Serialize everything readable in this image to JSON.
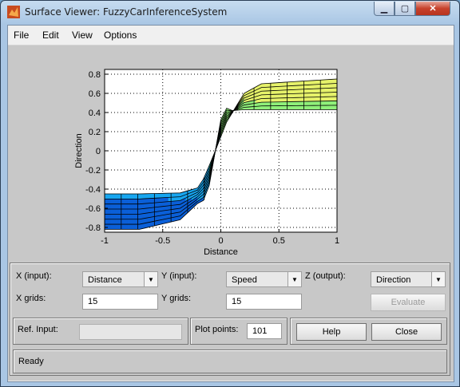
{
  "window": {
    "title": "Surface Viewer: FuzzyCarInferenceSystem",
    "app_icon": "matlab-icon"
  },
  "menu": [
    "File",
    "Edit",
    "View",
    "Options"
  ],
  "controls": {
    "x_label": "X (input):",
    "x_value": "Distance",
    "y_label": "Y (input):",
    "y_value": "Speed",
    "z_label": "Z (output):",
    "z_value": "Direction",
    "x_grids_label": "X grids:",
    "x_grids_value": "15",
    "y_grids_label": "Y grids:",
    "y_grids_value": "15",
    "evaluate_label": "Evaluate",
    "ref_input_label": "Ref. Input:",
    "ref_input_value": "",
    "plot_points_label": "Plot points:",
    "plot_points_value": "101",
    "help_label": "Help",
    "close_label": "Close",
    "status": "Ready"
  },
  "chart_data": {
    "type": "surface",
    "xlabel": "Distance",
    "ylabel": "Direction",
    "xlim": [
      -1,
      1
    ],
    "ylim": [
      -0.85,
      0.85
    ],
    "xticks": [
      "-1",
      "-0.5",
      "0",
      "0.5",
      "1"
    ],
    "yticks": [
      "0.8",
      "0.6",
      "0.4",
      "0.2",
      "0",
      "-0.2",
      "-0.4",
      "-0.6",
      "-0.8"
    ],
    "grid": true,
    "colormap": [
      "#0a5fd8",
      "#17a6f0",
      "#2fd6c6",
      "#8ff07a",
      "#e6f26a"
    ],
    "profile_back": [
      [
        -1,
        -0.45
      ],
      [
        -0.7,
        -0.45
      ],
      [
        -0.35,
        -0.44
      ],
      [
        -0.18,
        -0.38
      ],
      [
        -0.08,
        -0.1
      ],
      [
        0.05,
        0.3
      ],
      [
        0.2,
        0.6
      ],
      [
        0.35,
        0.7
      ],
      [
        0.6,
        0.72
      ],
      [
        1,
        0.75
      ]
    ],
    "profile_front": [
      [
        -1,
        -0.82
      ],
      [
        -0.7,
        -0.82
      ],
      [
        -0.35,
        -0.72
      ],
      [
        -0.2,
        -0.55
      ],
      [
        -0.12,
        -0.5
      ],
      [
        0.02,
        0.46
      ],
      [
        0.1,
        0.42
      ],
      [
        0.2,
        0.43
      ],
      [
        0.6,
        0.43
      ],
      [
        1,
        0.43
      ]
    ]
  }
}
